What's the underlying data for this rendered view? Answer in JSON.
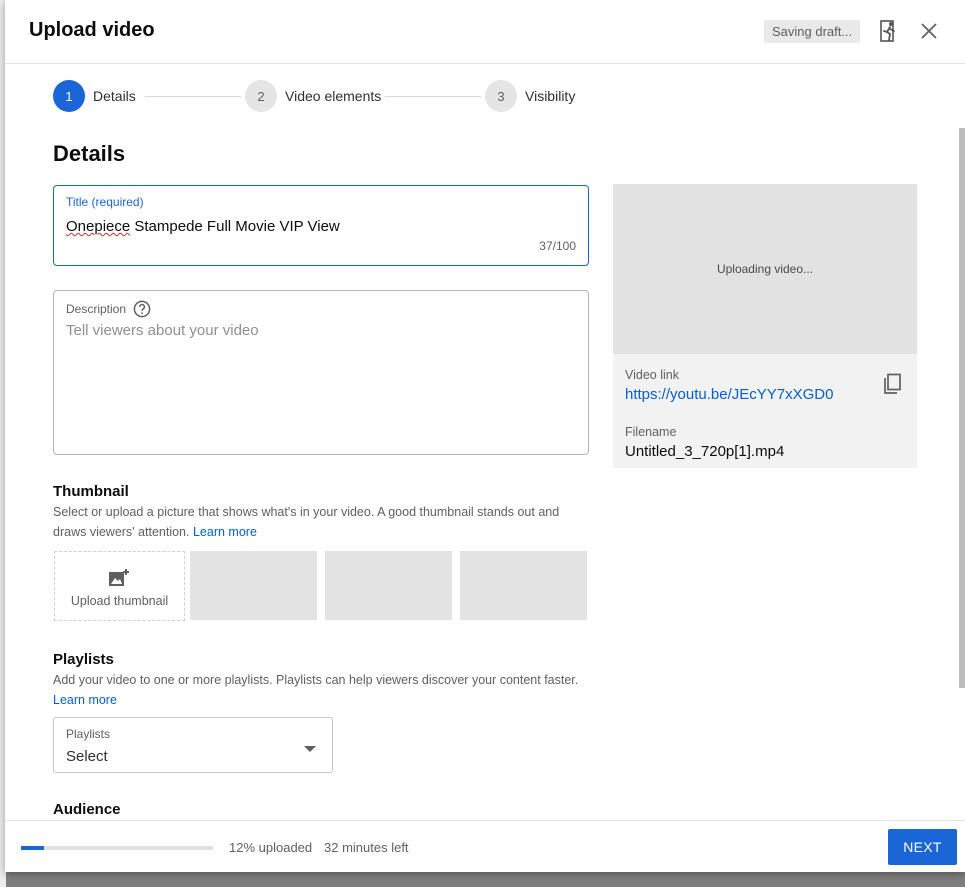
{
  "header": {
    "title": "Upload video",
    "saving_status": "Saving draft...",
    "exit_icon": "exit-icon",
    "close_icon": "close-icon"
  },
  "stepper": {
    "steps": [
      {
        "number": "1",
        "label": "Details",
        "active": true
      },
      {
        "number": "2",
        "label": "Video elements",
        "active": false
      },
      {
        "number": "3",
        "label": "Visibility",
        "active": false
      }
    ]
  },
  "details": {
    "heading": "Details",
    "title_field": {
      "label": "Title (required)",
      "value_spellchecked": "Onepiece",
      "value_rest": " Stampede Full Movie VIP View",
      "counter": "37/100"
    },
    "description_field": {
      "label": "Description",
      "placeholder": "Tell viewers about your video",
      "help_icon": "help-circle-icon"
    },
    "thumbnail": {
      "heading": "Thumbnail",
      "text": "Select or upload a picture that shows what's in your video. A good thumbnail stands out and draws viewers' attention.",
      "learn_more": "Learn more",
      "upload_label": "Upload thumbnail",
      "upload_icon": "add-photo-icon"
    },
    "playlists": {
      "heading": "Playlists",
      "text": "Add your video to one or more playlists. Playlists can help viewers discover your content faster.",
      "learn_more": "Learn more",
      "select_label": "Playlists",
      "select_value": "Select"
    },
    "audience": {
      "heading": "Audience"
    }
  },
  "preview": {
    "status": "Uploading video...",
    "video_link_label": "Video link",
    "video_link": "https://youtu.be/JEcYY7xXGD0",
    "filename_label": "Filename",
    "filename": "Untitled_3_720p[1].mp4",
    "copy_icon": "copy-icon"
  },
  "footer": {
    "progress_percent": 12,
    "uploaded_text": "12% uploaded",
    "time_left": "32 minutes left",
    "next_label": "NEXT"
  },
  "colors": {
    "accent": "#1a66d6",
    "link": "#065fd4"
  }
}
